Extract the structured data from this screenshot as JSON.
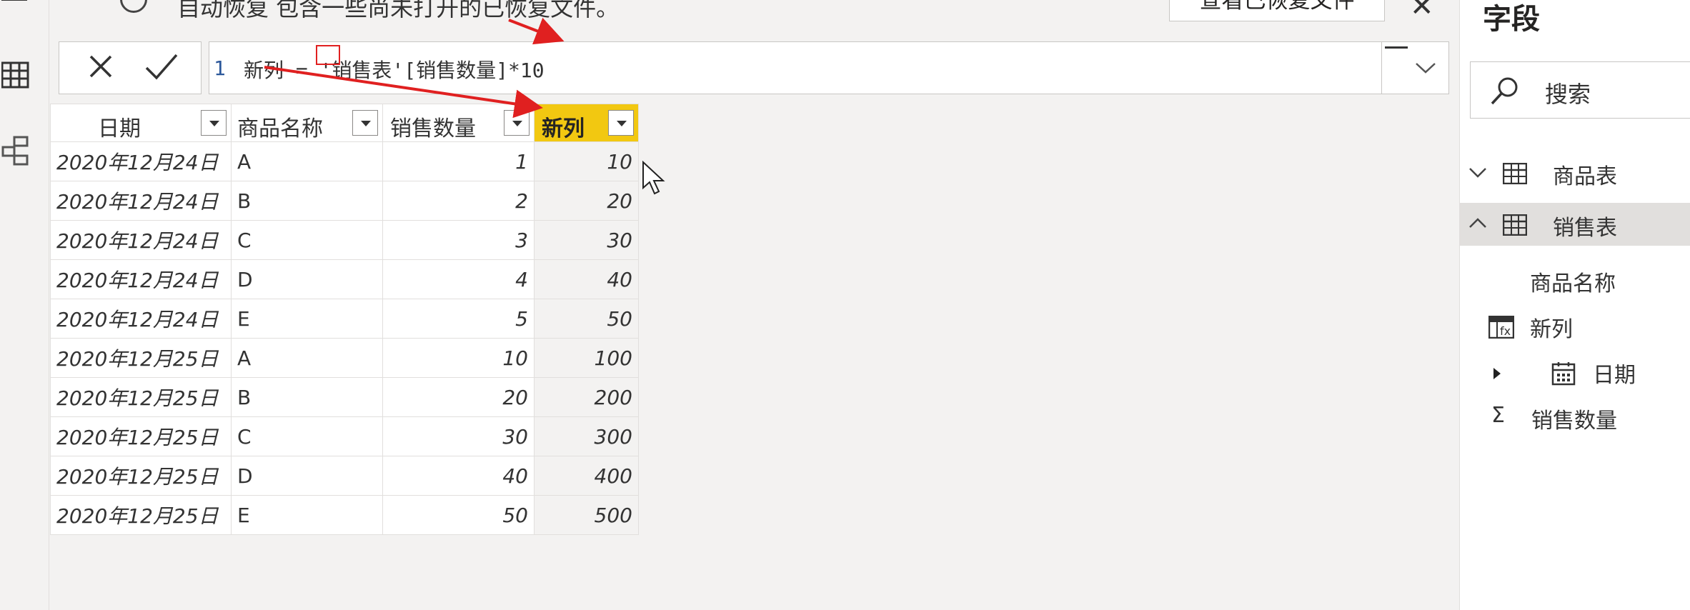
{
  "notification": {
    "message": "自动恢复 包含一些尚未打开的已恢复文件。",
    "button_label": "查看已恢复文件",
    "close_glyph": "✕"
  },
  "formula_bar": {
    "line_number": "1",
    "formula": "新列 = '销售表'[销售数量]*10"
  },
  "table": {
    "headers": [
      "日期",
      "商品名称",
      "销售数量",
      "新列"
    ],
    "selected_column": "新列",
    "rows": [
      {
        "date": "2020年12月24日",
        "name": "A",
        "qty": "1",
        "new": "10"
      },
      {
        "date": "2020年12月24日",
        "name": "B",
        "qty": "2",
        "new": "20"
      },
      {
        "date": "2020年12月24日",
        "name": "C",
        "qty": "3",
        "new": "30"
      },
      {
        "date": "2020年12月24日",
        "name": "D",
        "qty": "4",
        "new": "40"
      },
      {
        "date": "2020年12月24日",
        "name": "E",
        "qty": "5",
        "new": "50"
      },
      {
        "date": "2020年12月25日",
        "name": "A",
        "qty": "10",
        "new": "100"
      },
      {
        "date": "2020年12月25日",
        "name": "B",
        "qty": "20",
        "new": "200"
      },
      {
        "date": "2020年12月25日",
        "name": "C",
        "qty": "30",
        "new": "300"
      },
      {
        "date": "2020年12月25日",
        "name": "D",
        "qty": "40",
        "new": "400"
      },
      {
        "date": "2020年12月25日",
        "name": "E",
        "qty": "50",
        "new": "500"
      }
    ]
  },
  "fields_pane": {
    "title": "字段",
    "search_placeholder": "搜索",
    "tables": [
      {
        "name": "商品表",
        "expanded": false
      },
      {
        "name": "销售表",
        "expanded": true
      }
    ],
    "sales_fields": [
      {
        "name": "商品名称",
        "icon": "none"
      },
      {
        "name": "新列",
        "icon": "calculated-column-icon"
      },
      {
        "name": "日期",
        "icon": "calendar-icon"
      },
      {
        "name": "销售数量",
        "icon": "sigma-icon"
      }
    ]
  },
  "colors": {
    "selected_header": "#f2c811",
    "annotation_red": "#e02020",
    "formula_line_number": "#2b579a"
  }
}
